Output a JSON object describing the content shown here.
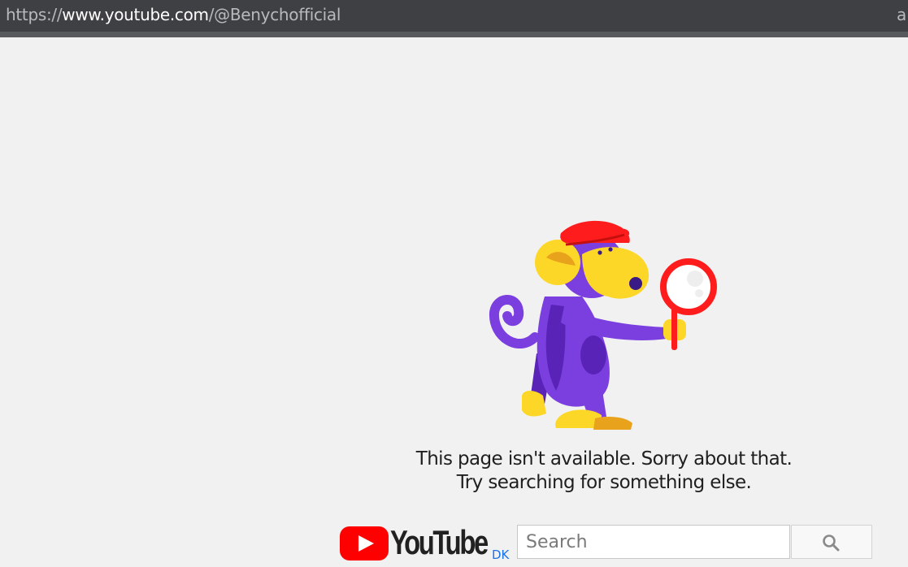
{
  "browser": {
    "url_scheme": "https://",
    "url_host": "www.youtube.com",
    "url_path": "/@Benychofficial",
    "url_right_fragment": "a"
  },
  "error": {
    "line1": "This page isn't available. Sorry about that.",
    "line2": "Try searching for something else.",
    "illustration": "monkey-with-magnifying-glass"
  },
  "footer": {
    "logo_text": "YouTube",
    "country_code": "DK",
    "search_placeholder": "Search",
    "search_button_icon": "search-icon"
  },
  "colors": {
    "youtube_red": "#ff0000",
    "background": "#f1f1f1",
    "url_bar": "#3f4043",
    "country_code": "#1a73e8"
  }
}
